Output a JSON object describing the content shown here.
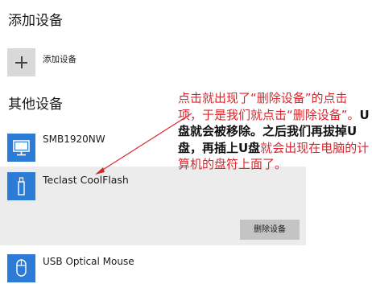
{
  "sections": {
    "add_devices_title": "添加设备",
    "other_devices_title": "其他设备"
  },
  "add_device": {
    "label": "添加设备",
    "icon": "plus-icon"
  },
  "devices": [
    {
      "name": "SMB1920NW",
      "icon": "monitor-icon"
    },
    {
      "name": "Teclast CoolFlash",
      "icon": "usb-drive-icon",
      "selected": true,
      "action_label": "删除设备"
    },
    {
      "name": "USB Optical Mouse",
      "icon": "mouse-icon"
    }
  ],
  "annotation": {
    "part1": "点击就出现了“删除设备”的点击项，于是我们就点击“删除设备”。",
    "part2": "U盘就会被移除。之后我们再拔掉U盘，再插上U盘",
    "part3": "就会出现在电脑的计算机的盘符上面了。"
  },
  "colors": {
    "accent": "#2c7bd6",
    "annotation_red": "#d9262d",
    "selected_bg": "#ececec",
    "button_bg": "#c4c4c4"
  }
}
